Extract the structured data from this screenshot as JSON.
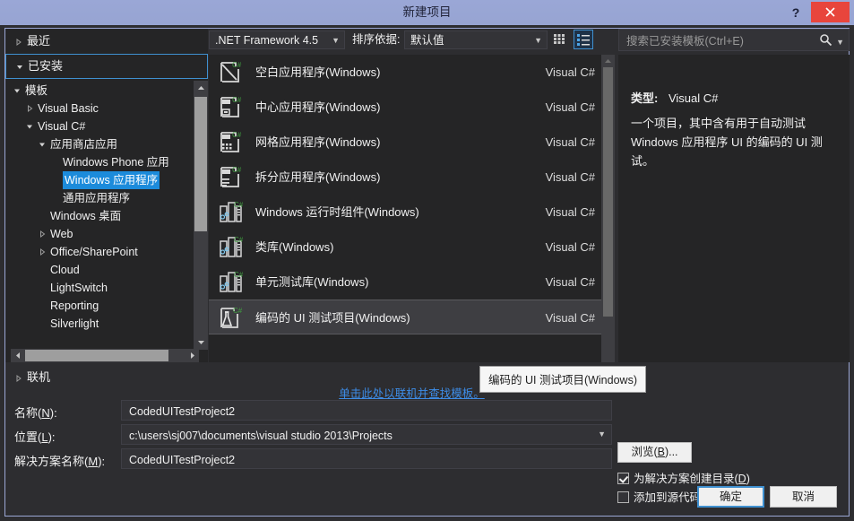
{
  "window": {
    "title": "新建项目",
    "help_icon": "?",
    "close_icon": "close-icon"
  },
  "sidebar": {
    "recent": {
      "label": "最近",
      "expanded": false
    },
    "installed": {
      "label": "已安装",
      "expanded": true,
      "selected": true
    },
    "tree": [
      {
        "label": "模板",
        "indent": 0,
        "arrow": "down",
        "selected": false
      },
      {
        "label": "Visual Basic",
        "indent": 1,
        "arrow": "right",
        "selected": false
      },
      {
        "label": "Visual C#",
        "indent": 1,
        "arrow": "down",
        "selected": false
      },
      {
        "label": "应用商店应用",
        "indent": 2,
        "arrow": "down",
        "selected": false
      },
      {
        "label": "Windows Phone 应用",
        "indent": 3,
        "arrow": "none",
        "selected": false
      },
      {
        "label": "Windows 应用程序",
        "indent": 3,
        "arrow": "none",
        "selected": true
      },
      {
        "label": "通用应用程序",
        "indent": 3,
        "arrow": "none",
        "selected": false
      },
      {
        "label": "Windows 桌面",
        "indent": 2,
        "arrow": "none",
        "selected": false
      },
      {
        "label": "Web",
        "indent": 2,
        "arrow": "right",
        "selected": false
      },
      {
        "label": "Office/SharePoint",
        "indent": 2,
        "arrow": "right",
        "selected": false
      },
      {
        "label": "Cloud",
        "indent": 2,
        "arrow": "none",
        "selected": false
      },
      {
        "label": "LightSwitch",
        "indent": 2,
        "arrow": "none",
        "selected": false
      },
      {
        "label": "Reporting",
        "indent": 2,
        "arrow": "none",
        "selected": false
      },
      {
        "label": "Silverlight",
        "indent": 2,
        "arrow": "none",
        "selected": false
      }
    ],
    "online": {
      "label": "联机",
      "expanded": false
    }
  },
  "toolbar": {
    "framework": {
      "value": ".NET Framework 4.5",
      "arrow": "▼"
    },
    "sort_label": "排序依据:",
    "sort": {
      "value": "默认值",
      "arrow": "▼"
    },
    "grid_view_icon": "grid-view-icon",
    "list_view_icon": "list-view-icon"
  },
  "search": {
    "placeholder": "搜索已安装模板(Ctrl+E)",
    "value": "",
    "icon": "search-icon",
    "dropdown_arrow": "▼"
  },
  "templates": {
    "language_column": "Visual C#",
    "items": [
      {
        "name": "空白应用程序(Windows)",
        "language": "Visual C#",
        "icon": "blank-app-icon",
        "selected": false
      },
      {
        "name": "中心应用程序(Windows)",
        "language": "Visual C#",
        "icon": "hub-app-icon",
        "selected": false
      },
      {
        "name": "网格应用程序(Windows)",
        "language": "Visual C#",
        "icon": "grid-app-icon",
        "selected": false
      },
      {
        "name": "拆分应用程序(Windows)",
        "language": "Visual C#",
        "icon": "split-app-icon",
        "selected": false
      },
      {
        "name": "Windows 运行时组件(Windows)",
        "language": "Visual C#",
        "icon": "winrt-component-icon",
        "selected": false
      },
      {
        "name": "类库(Windows)",
        "language": "Visual C#",
        "icon": "class-library-icon",
        "selected": false
      },
      {
        "name": "单元测试库(Windows)",
        "language": "Visual C#",
        "icon": "unit-test-icon",
        "selected": false
      },
      {
        "name": "编码的 UI 测试项目(Windows)",
        "language": "Visual C#",
        "icon": "coded-ui-test-icon",
        "selected": true
      }
    ],
    "find_online_link": "单击此处以联机并查找模板。",
    "tooltip": "编码的 UI 测试项目(Windows)"
  },
  "description": {
    "type_label": "类型:",
    "type_value": "Visual C#",
    "text": "一个项目，其中含有用于自动测试 Windows 应用程序 UI 的编码的 UI 测试。"
  },
  "form": {
    "name_label": "名称(N):",
    "name_value": "CodedUITestProject2",
    "location_label": "位置(L):",
    "location_value": "c:\\users\\sj007\\documents\\visual studio 2013\\Projects",
    "location_arrow": "▼",
    "solution_label": "解决方案名称(M):",
    "solution_value": "CodedUITestProject2",
    "browse_button": "浏览(B)...",
    "create_dir_checkbox": {
      "label": "为解决方案创建目录(D)",
      "checked": true
    },
    "source_control_checkbox": {
      "label": "添加到源代码管理(U)",
      "checked": false
    },
    "ok_button": "确定",
    "cancel_button": "取消"
  },
  "colors": {
    "title_bar": "#9aa6d4",
    "close_red": "#e8453c",
    "panel_bg": "#252526",
    "dialog_bg": "#2d2d30",
    "selection_blue": "#1c8bdb",
    "link_blue": "#3d8ce6",
    "focus_blue": "#3f90d0",
    "csharp_green": "#3f9e3f"
  }
}
